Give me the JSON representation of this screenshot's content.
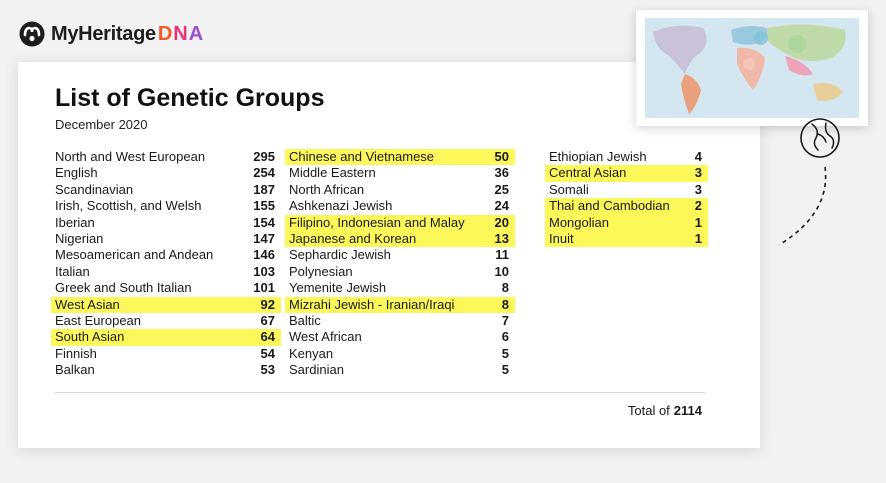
{
  "brand": {
    "name": "MyHeritage",
    "dna": "DNA"
  },
  "card": {
    "title": "List of Genetic Groups",
    "date": "December 2020",
    "columns": [
      [
        {
          "name": "North and West European",
          "count": "295",
          "highlight": false
        },
        {
          "name": "English",
          "count": "254",
          "highlight": false
        },
        {
          "name": "Scandinavian",
          "count": "187",
          "highlight": false
        },
        {
          "name": "Irish, Scottish, and Welsh",
          "count": "155",
          "highlight": false
        },
        {
          "name": "Iberian",
          "count": "154",
          "highlight": false
        },
        {
          "name": "Nigerian",
          "count": "147",
          "highlight": false
        },
        {
          "name": "Mesoamerican and Andean",
          "count": "146",
          "highlight": false
        },
        {
          "name": "Italian",
          "count": "103",
          "highlight": false
        },
        {
          "name": "Greek and South Italian",
          "count": "101",
          "highlight": false
        },
        {
          "name": "West Asian",
          "count": "92",
          "highlight": true
        },
        {
          "name": "East European",
          "count": "67",
          "highlight": false
        },
        {
          "name": "South Asian",
          "count": "64",
          "highlight": true
        },
        {
          "name": "Finnish",
          "count": "54",
          "highlight": false
        },
        {
          "name": "Balkan",
          "count": "53",
          "highlight": false
        }
      ],
      [
        {
          "name": "Chinese and Vietnamese",
          "count": "50",
          "highlight": true
        },
        {
          "name": "Middle Eastern",
          "count": "36",
          "highlight": false
        },
        {
          "name": "North African",
          "count": "25",
          "highlight": false
        },
        {
          "name": "Ashkenazi Jewish",
          "count": "24",
          "highlight": false
        },
        {
          "name": "Filipino, Indonesian and Malay",
          "count": "20",
          "highlight": true
        },
        {
          "name": "Japanese and Korean",
          "count": "13",
          "highlight": true
        },
        {
          "name": "Sephardic Jewish",
          "count": "11",
          "highlight": false
        },
        {
          "name": "Polynesian",
          "count": "10",
          "highlight": false
        },
        {
          "name": "Yemenite Jewish",
          "count": "8",
          "highlight": false
        },
        {
          "name": "Mizrahi Jewish - Iranian/Iraqi",
          "count": "8",
          "highlight": true
        },
        {
          "name": "Baltic",
          "count": "7",
          "highlight": false
        },
        {
          "name": "West African",
          "count": "6",
          "highlight": false
        },
        {
          "name": "Kenyan",
          "count": "5",
          "highlight": false
        },
        {
          "name": "Sardinian",
          "count": "5",
          "highlight": false
        }
      ],
      [
        {
          "name": "Ethiopian Jewish",
          "count": "4",
          "highlight": false
        },
        {
          "name": "Central Asian",
          "count": "3",
          "highlight": true
        },
        {
          "name": "Somali",
          "count": "3",
          "highlight": false
        },
        {
          "name": "Thai and Cambodian",
          "count": "2",
          "highlight": true
        },
        {
          "name": "Mongolian",
          "count": "1",
          "highlight": true
        },
        {
          "name": "Inuit",
          "count": "1",
          "highlight": true
        }
      ]
    ],
    "total_label": "Total of",
    "total_value": "2114"
  },
  "colors": {
    "highlight": "#fdf85a",
    "logo_orange": "#f05a28",
    "logo_pink": "#e8337a",
    "logo_purple": "#9b4dd2"
  },
  "icons": [
    "myheritage-logo-icon",
    "world-map-icon",
    "globe-icon"
  ]
}
